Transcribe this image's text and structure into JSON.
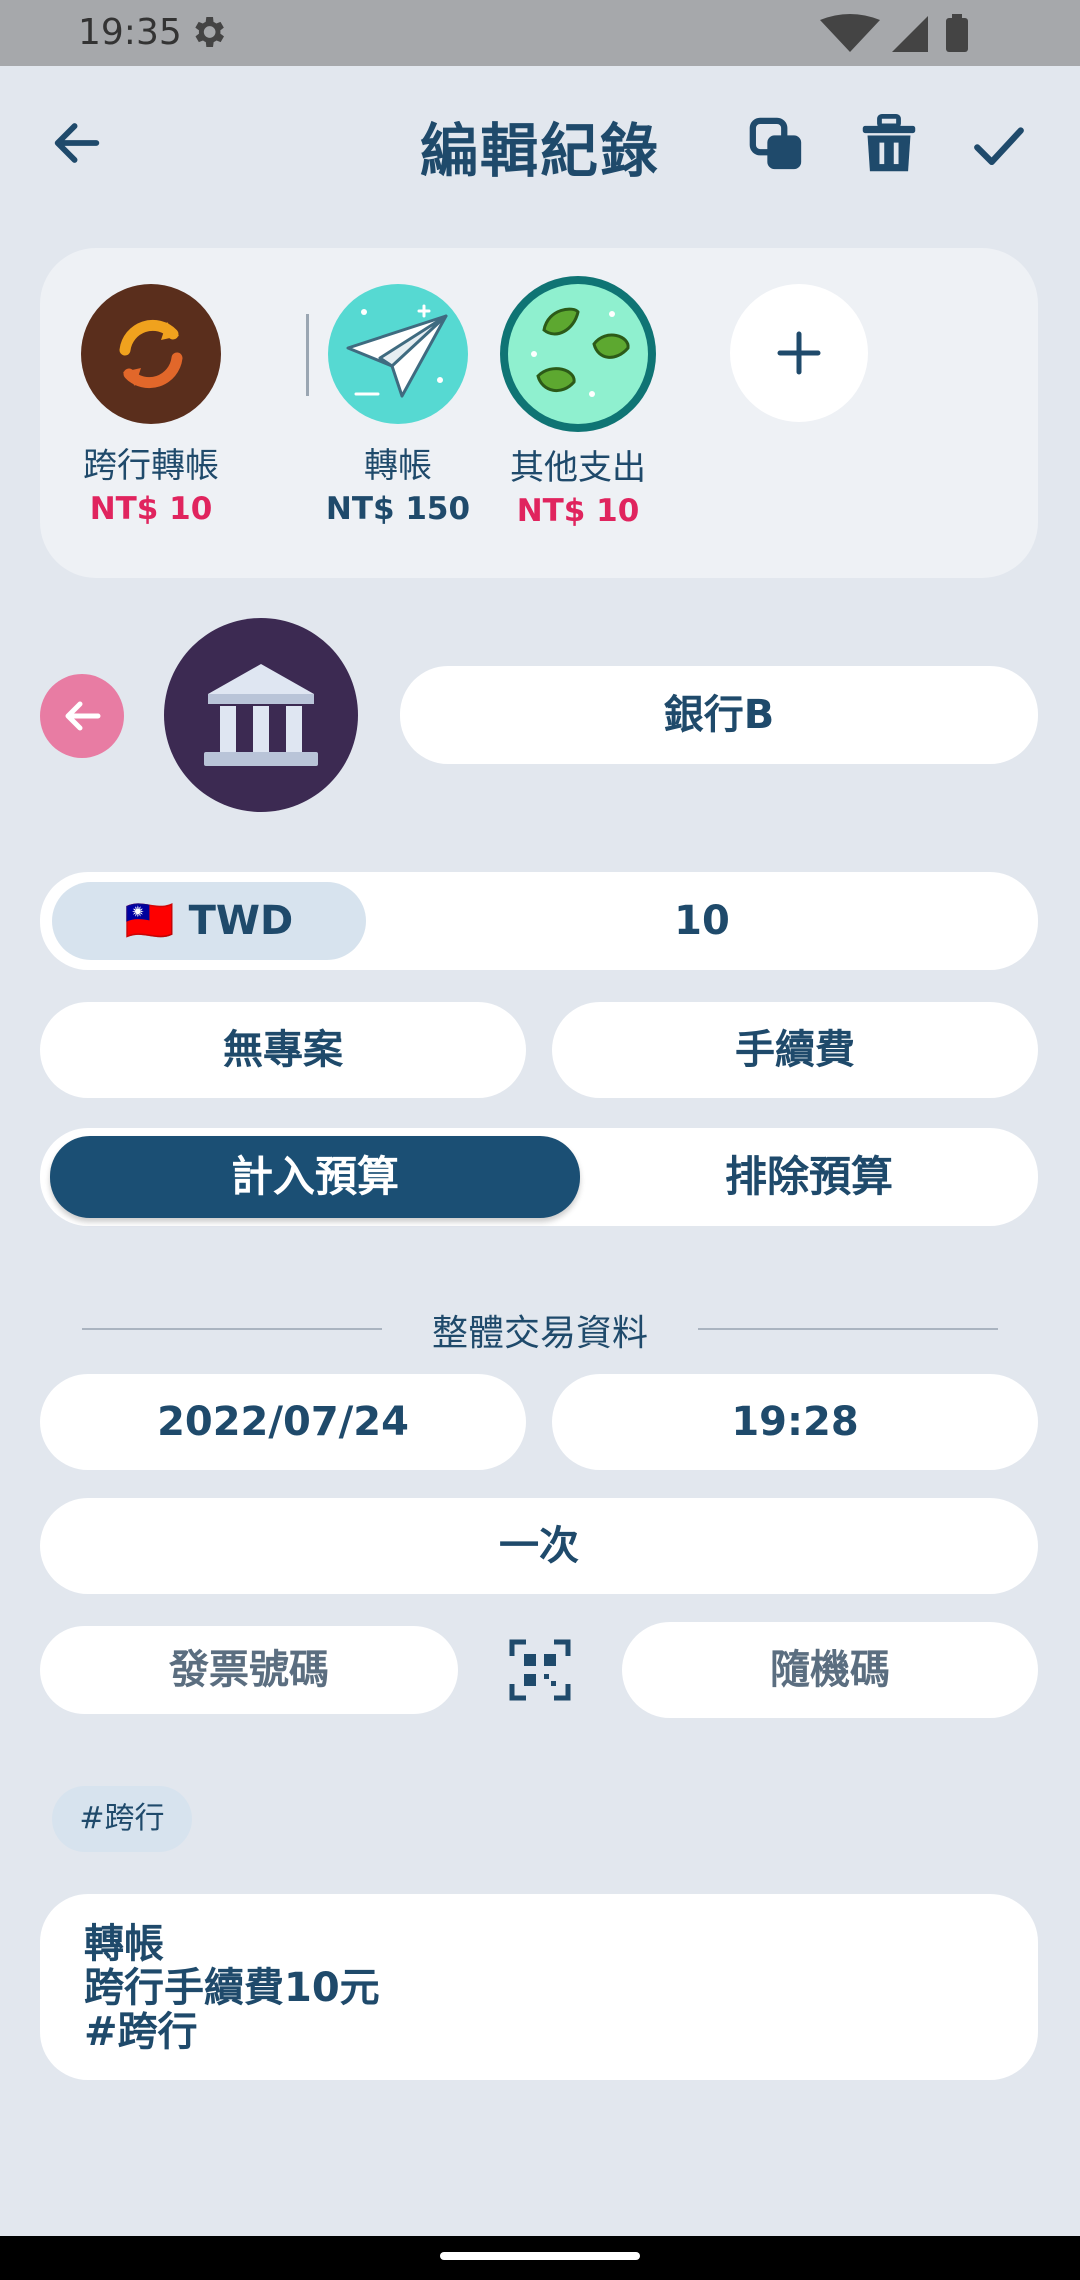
{
  "status_bar": {
    "time": "19:35"
  },
  "header": {
    "title": "編輯紀錄"
  },
  "categories": [
    {
      "name": "跨行轉帳",
      "amount": "NT$ 10"
    },
    {
      "name": "轉帳",
      "amount": "NT$ 150"
    },
    {
      "name": "其他支出",
      "amount": "NT$ 10"
    }
  ],
  "account": {
    "name": "銀行B"
  },
  "amount": {
    "currency": "TWD",
    "flag": "🇹🇼",
    "value": "10"
  },
  "project": {
    "label": "無專案"
  },
  "fee": {
    "label": "手續費"
  },
  "budget": {
    "include": "計入預算",
    "exclude": "排除預算",
    "selected": "include"
  },
  "section": {
    "label": "整體交易資料"
  },
  "date": {
    "value": "2022/07/24"
  },
  "time": {
    "value": "19:28"
  },
  "repeat": {
    "label": "一次"
  },
  "invoice": {
    "label": "發票號碼",
    "random_code": "隨機碼"
  },
  "tags": [
    "#跨行"
  ],
  "note": {
    "lines": [
      "轉帳",
      "跨行手續費10元",
      "#跨行"
    ]
  },
  "colors": {
    "accent": "#1b4f74",
    "expense": "#e0245e",
    "swap": "#e87ca3",
    "bank_bg": "#3c2a52"
  }
}
